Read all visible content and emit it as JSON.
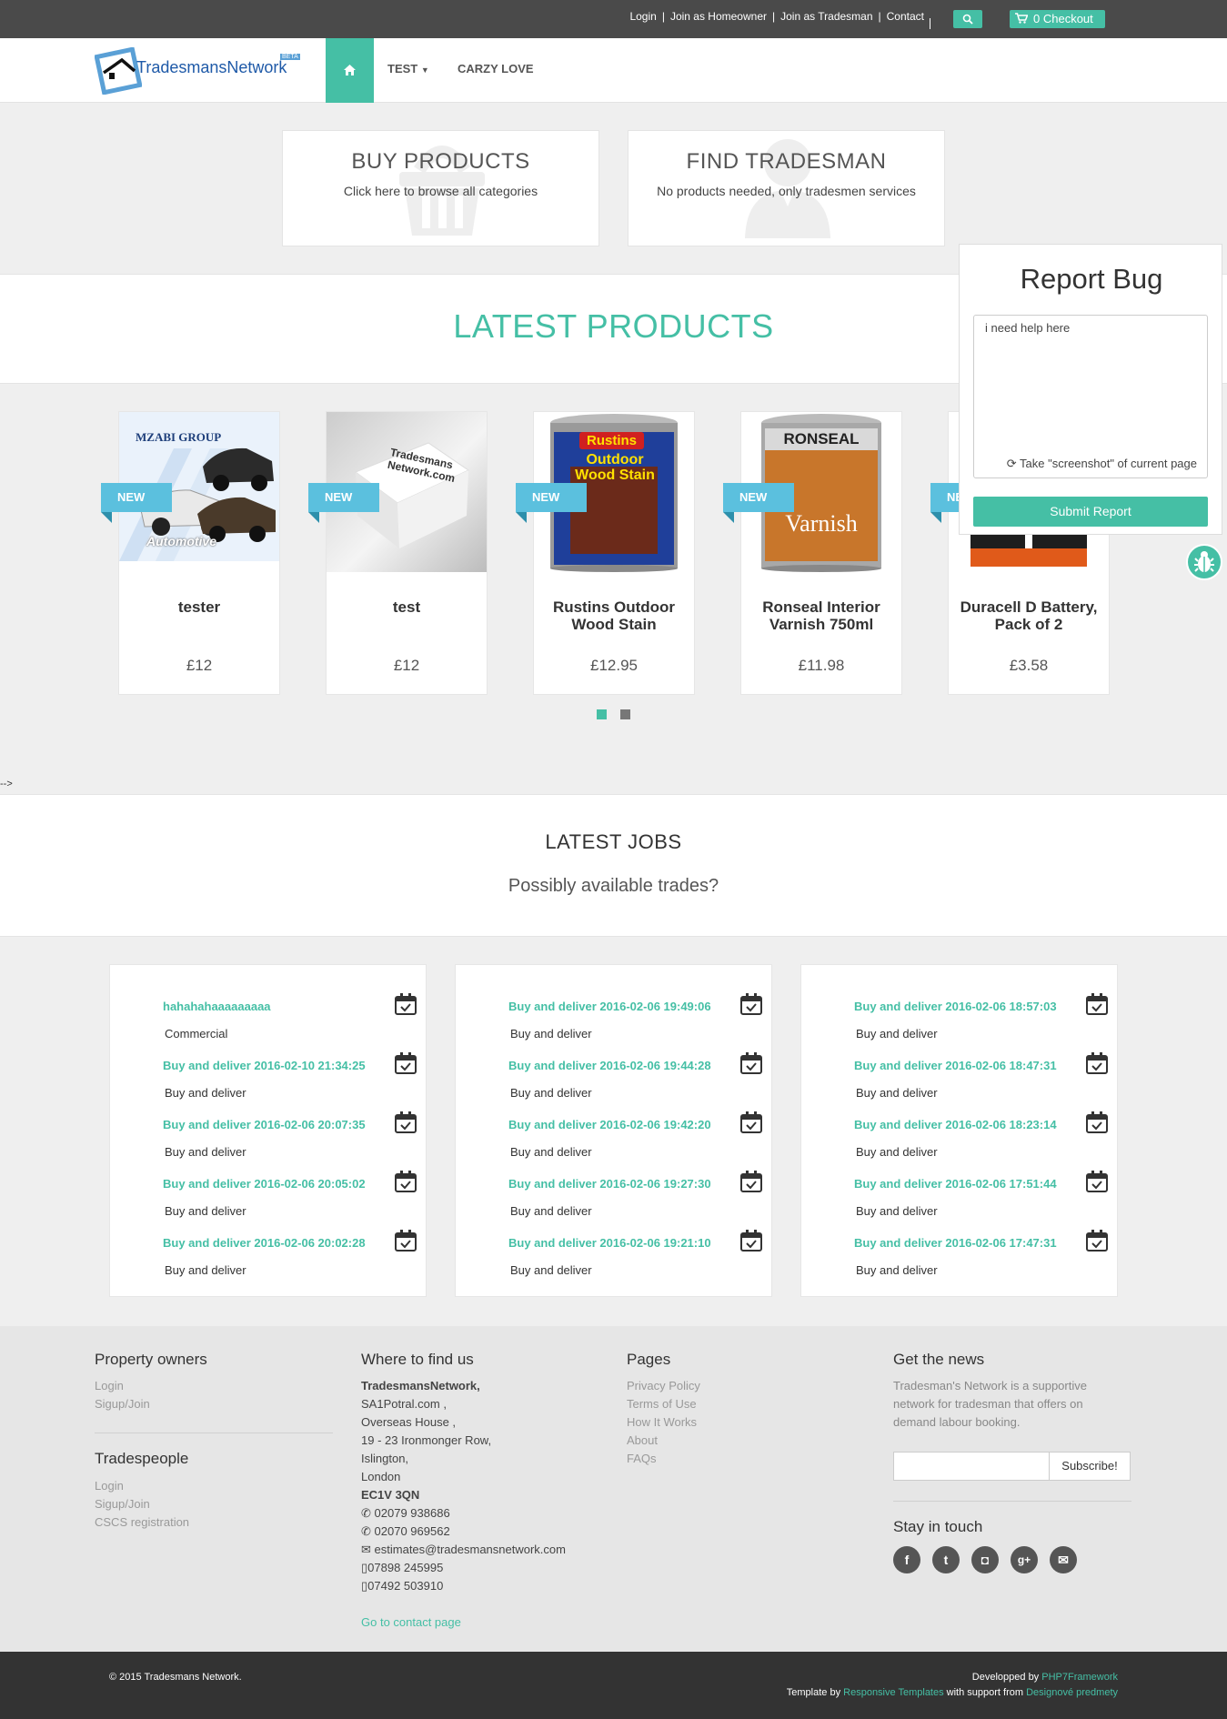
{
  "topbar": {
    "links": [
      "Login",
      "Join as Homeowner",
      "Join as Tradesman",
      "Contact"
    ],
    "separator": "|",
    "checkout_label": "0 Checkout"
  },
  "nav": {
    "logo_text": "TradesmansNetwork",
    "logo_badge": "BETA",
    "items": [
      "TEST",
      "CARZY LOVE"
    ]
  },
  "hero": [
    {
      "title": "BUY PRODUCTS",
      "subtitle": "Click here to browse all categories",
      "icon": "basket-icon"
    },
    {
      "title": "FIND TRADESMAN",
      "subtitle": "No products needed, only tradesmen services",
      "icon": "person-icon"
    }
  ],
  "latest_products": {
    "title": "LATEST PRODUCTS",
    "badge": "NEW",
    "items": [
      {
        "name": "tester",
        "price": "£12",
        "image_text": "MZABI GROUP",
        "image_caption": "Automotive"
      },
      {
        "name": "test",
        "price": "£12",
        "image_text": "Tradesmans Network.com"
      },
      {
        "name": "Rustins Outdoor Wood Stain",
        "price": "£12.95",
        "image_text": "Rustins",
        "image_caption": "Outdoor Wood Stain"
      },
      {
        "name": "Ronseal Interior Varnish 750ml",
        "price": "£11.98",
        "image_text": "RONSEAL",
        "image_caption": "Varnish"
      },
      {
        "name": "Duracell D Battery, Pack of 2",
        "price": "£3.58"
      }
    ],
    "pager_dots": 2,
    "pager_active": 0
  },
  "stray_text": "-->",
  "latest_jobs": {
    "title": "LATEST JOBS",
    "subtitle": "Possibly available trades?",
    "columns": [
      [
        {
          "title": "hahahahaaaaaaaaa",
          "desc": "Commercial"
        },
        {
          "title": "Buy and deliver 2016-02-10 21:34:25",
          "desc": "Buy and deliver"
        },
        {
          "title": "Buy and deliver 2016-02-06 20:07:35",
          "desc": "Buy and deliver"
        },
        {
          "title": "Buy and deliver 2016-02-06 20:05:02",
          "desc": "Buy and deliver"
        },
        {
          "title": "Buy and deliver 2016-02-06 20:02:28",
          "desc": "Buy and deliver"
        }
      ],
      [
        {
          "title": "Buy and deliver 2016-02-06 19:49:06",
          "desc": "Buy and deliver"
        },
        {
          "title": "Buy and deliver 2016-02-06 19:44:28",
          "desc": "Buy and deliver"
        },
        {
          "title": "Buy and deliver 2016-02-06 19:42:20",
          "desc": "Buy and deliver"
        },
        {
          "title": "Buy and deliver 2016-02-06 19:27:30",
          "desc": "Buy and deliver"
        },
        {
          "title": "Buy and deliver 2016-02-06 19:21:10",
          "desc": "Buy and deliver"
        }
      ],
      [
        {
          "title": "Buy and deliver 2016-02-06 18:57:03",
          "desc": "Buy and deliver"
        },
        {
          "title": "Buy and deliver 2016-02-06 18:47:31",
          "desc": "Buy and deliver"
        },
        {
          "title": "Buy and deliver 2016-02-06 18:23:14",
          "desc": "Buy and deliver"
        },
        {
          "title": "Buy and deliver 2016-02-06 17:51:44",
          "desc": "Buy and deliver"
        },
        {
          "title": "Buy and deliver 2016-02-06 17:47:31",
          "desc": "Buy and deliver"
        }
      ]
    ]
  },
  "footer": {
    "property_owners": {
      "title": "Property owners",
      "links": [
        "Login",
        "Sigup/Join"
      ]
    },
    "tradespeople": {
      "title": "Tradespeople",
      "links": [
        "Login",
        "Sigup/Join",
        "CSCS registration"
      ]
    },
    "where": {
      "title": "Where to find us",
      "company": "TradesmansNetwork,",
      "lines": [
        "SA1Potral.com ,",
        "Overseas House ,",
        "19 - 23 Ironmonger Row,",
        "Islington,",
        "London"
      ],
      "postcode": "EC1V 3QN",
      "phones": [
        "02079 938686",
        "02070 969562"
      ],
      "email": "estimates@tradesmansnetwork.com",
      "mobiles": [
        "07898 245995",
        "07492 503910"
      ],
      "contact_link": "Go to contact page"
    },
    "pages": {
      "title": "Pages",
      "links": [
        "Privacy Policy",
        "Terms of Use",
        "How It Works",
        "About",
        "FAQs"
      ]
    },
    "news": {
      "title": "Get the news",
      "text": "Tradesman's Network is a supportive network for tradesman that offers on demand labour booking.",
      "input_value": "",
      "button": "Subscribe!"
    },
    "stay": {
      "title": "Stay in touch",
      "icons": [
        "facebook-icon",
        "twitter-icon",
        "instagram-icon",
        "google-plus-icon",
        "email-icon"
      ]
    }
  },
  "bottom": {
    "copyright": "© 2015 Tradesmans Network.",
    "developed_prefix": "Developped by",
    "developed_by": "PHP7Framework",
    "template_prefix": "Template by",
    "template_by": "Responsive Templates",
    "support_prefix": "with support from",
    "support_by": "Designové predmety"
  },
  "report_bug": {
    "title": "Report Bug",
    "textarea_value": "i need help here",
    "screenshot_label": "Take \"screenshot\" of current page",
    "submit": "Submit Report"
  },
  "colors": {
    "accent": "#45bfa5",
    "badge": "#5bc0de",
    "topbar": "#4a4a4a",
    "bottom": "#333333"
  }
}
